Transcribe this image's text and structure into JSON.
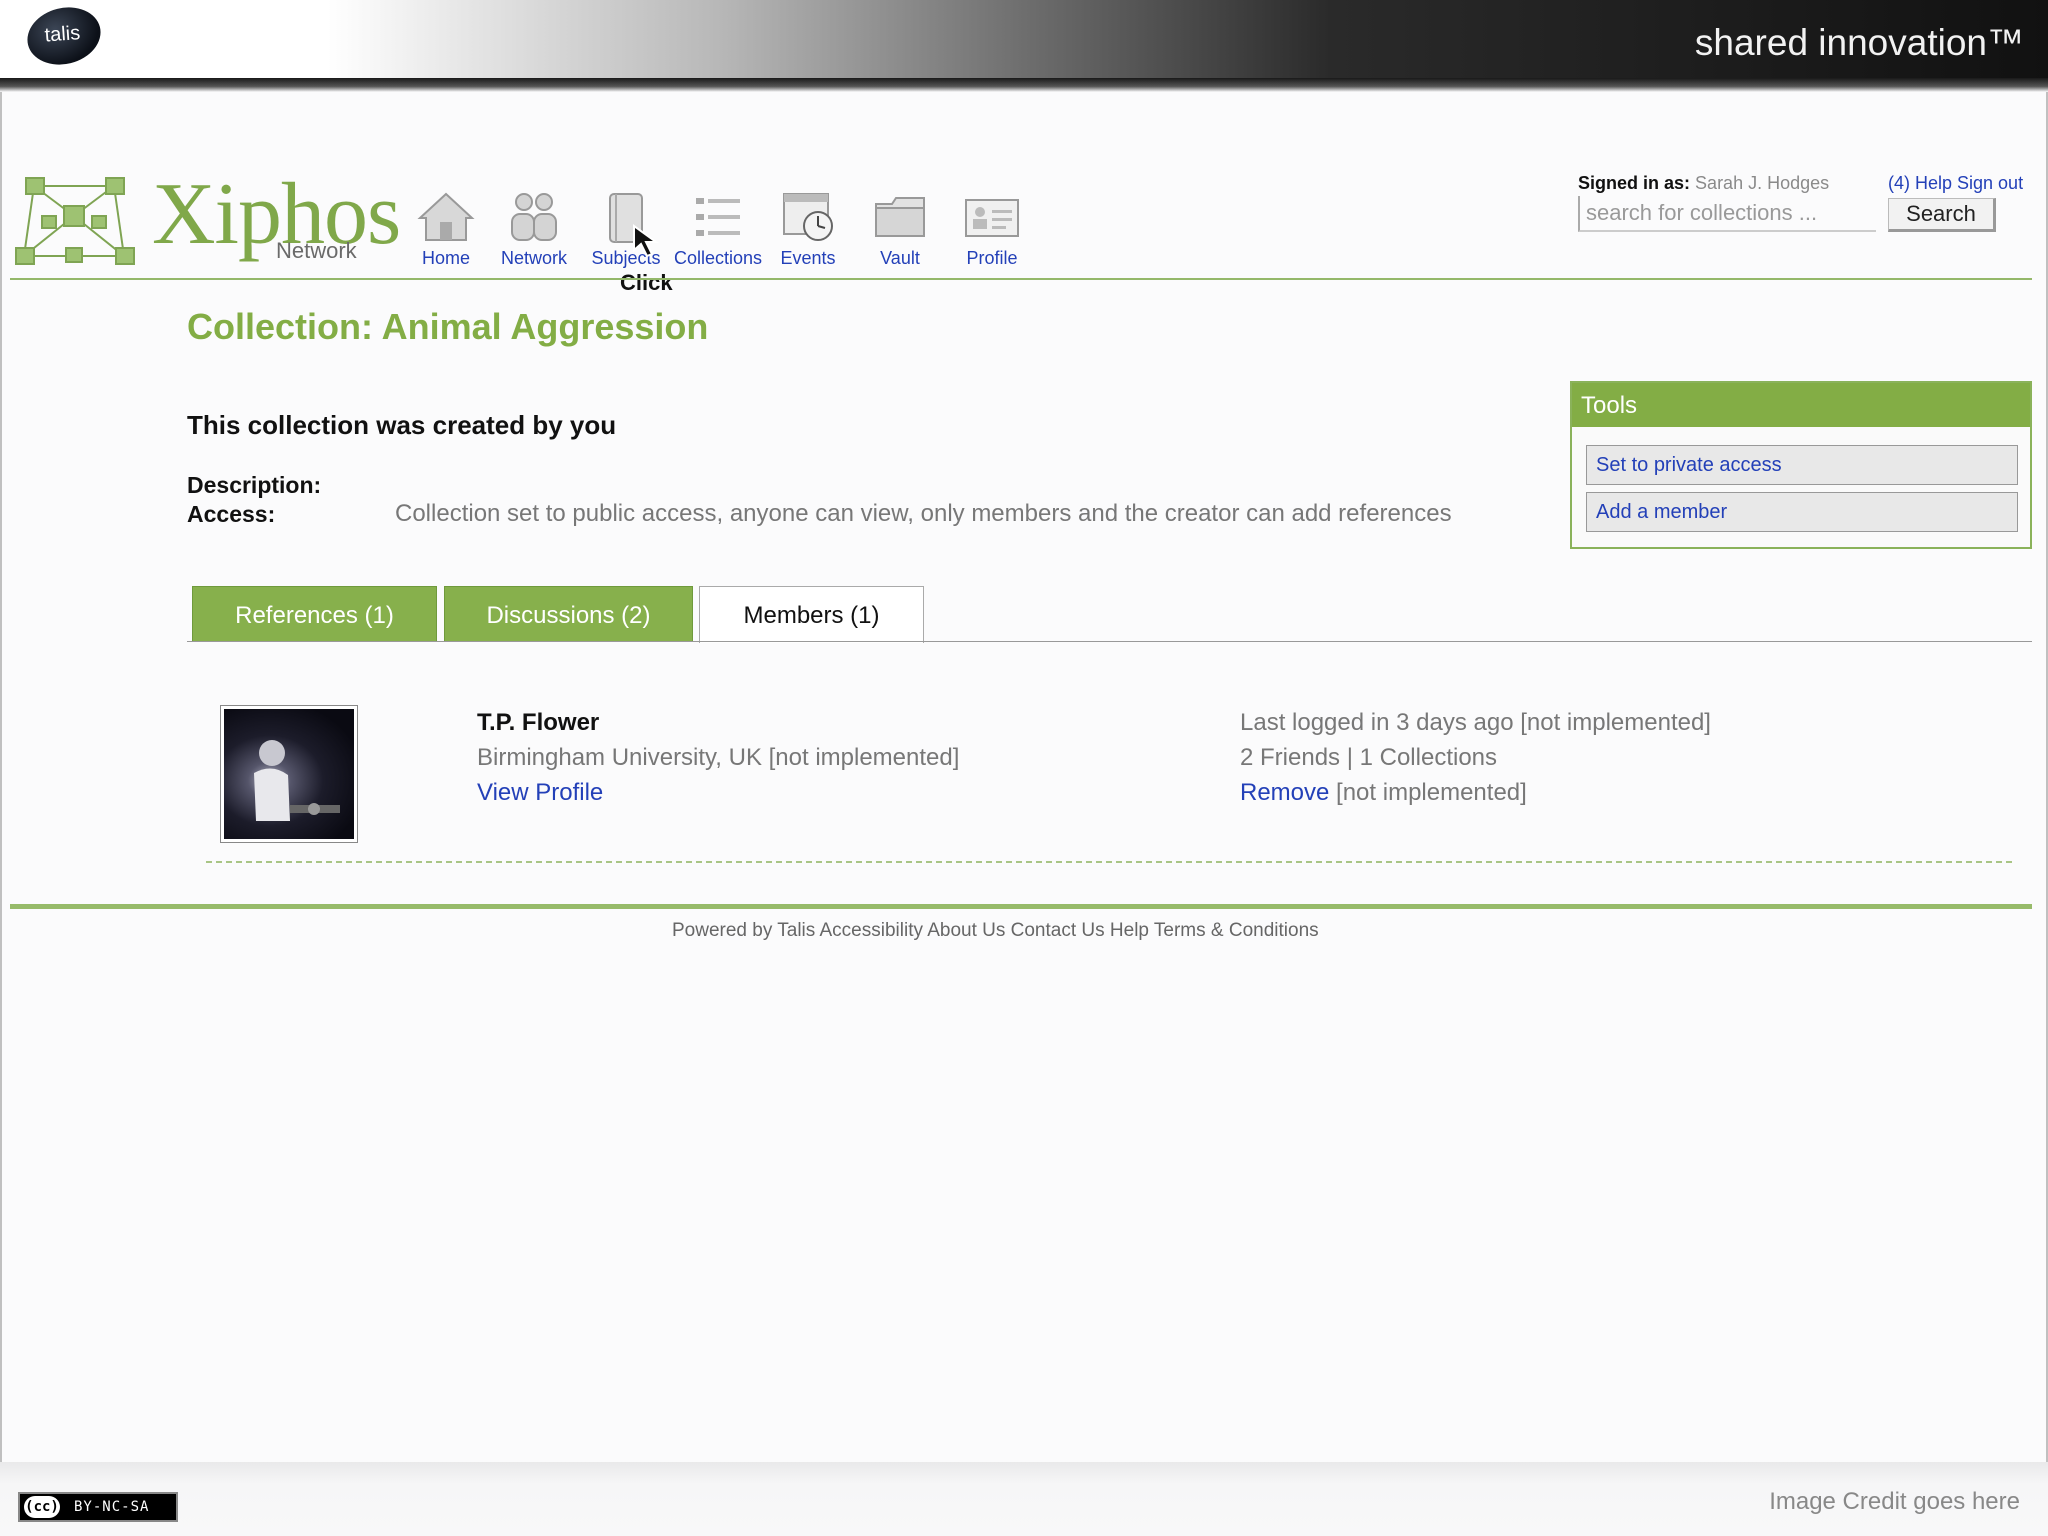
{
  "header": {
    "tagline": "shared innovation™",
    "logo_text": "talis"
  },
  "brand": {
    "name": "Xiphos",
    "subtitle": "Network"
  },
  "nav": {
    "items": [
      {
        "label": "Home",
        "icon": "home-icon"
      },
      {
        "label": "Network",
        "icon": "people-icon"
      },
      {
        "label": "Subjects",
        "icon": "notebook-icon"
      },
      {
        "label": "Collections",
        "icon": "list-icon"
      },
      {
        "label": "Events",
        "icon": "calendar-clock-icon"
      },
      {
        "label": "Vault",
        "icon": "folder-icon"
      },
      {
        "label": "Profile",
        "icon": "id-card-icon"
      }
    ],
    "click_annotation": "Click"
  },
  "account": {
    "signed_in_label": "Signed in as:",
    "user": "Sarah J. Hodges",
    "links": "(4) Help Sign out"
  },
  "search": {
    "placeholder": "search for collections ...",
    "button": "Search"
  },
  "page": {
    "title": "Collection: Animal Aggression",
    "created_note": "This collection was created by you",
    "description_label": "Description:",
    "access_label": "Access:",
    "access_text": "Collection set to public access, anyone can view, only members and the creator can add references"
  },
  "tools": {
    "title": "Tools",
    "items": [
      "Set to private access",
      "Add a member"
    ]
  },
  "tabs": [
    {
      "label": "References (1)"
    },
    {
      "label": "Discussions (2)"
    },
    {
      "label": "Members (1)"
    }
  ],
  "member": {
    "name": "T.P. Flower",
    "org": "Birmingham University, UK [not implemented]",
    "view_profile": "View Profile",
    "last_login": "Last logged in 3 days ago [not implemented]",
    "stats": "2 Friends | 1 Collections",
    "remove": "Remove",
    "remove_note": " [not implemented]"
  },
  "footer": {
    "text": "Powered by Talis Accessibility About Us Contact Us Help Terms & Conditions"
  },
  "slide_footer": {
    "license": "BY-NC-SA",
    "credit": "Image Credit goes here"
  },
  "colors": {
    "accent_green": "#83ad45",
    "link_blue": "#2340b8"
  }
}
